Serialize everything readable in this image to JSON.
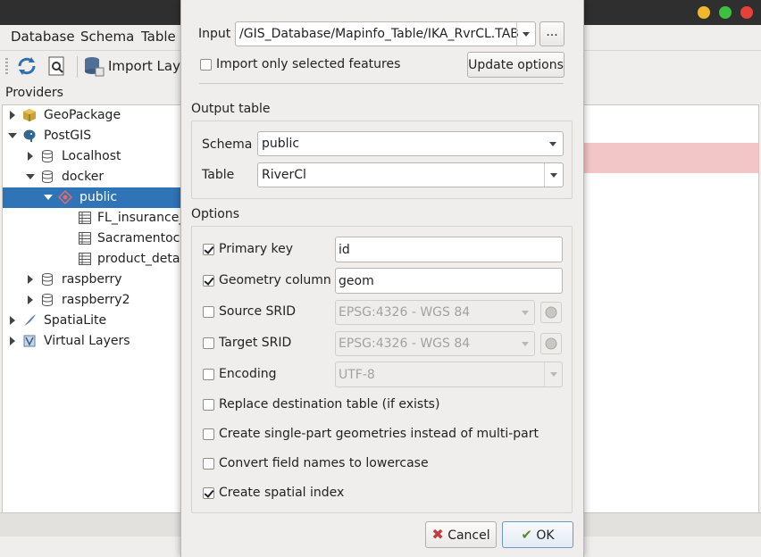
{
  "window": {
    "menu": [
      "Database",
      "Schema",
      "Table"
    ],
    "toolbar_import_label": "Import Layer",
    "providers_heading": "Providers",
    "tree": [
      {
        "label": "GeoPackage",
        "icon": "geopackage-icon"
      },
      {
        "label": "PostGIS",
        "icon": "postgis-elephant-icon"
      },
      {
        "label": "Localhost",
        "icon": "database-icon"
      },
      {
        "label": "docker",
        "icon": "database-icon"
      },
      {
        "label": "public",
        "icon": "schema-icon"
      },
      {
        "label": "FL_insurance_",
        "icon": "table-icon"
      },
      {
        "label": "Sacramentocr",
        "icon": "table-icon"
      },
      {
        "label": "product_detail",
        "icon": "table-icon"
      },
      {
        "label": "raspberry",
        "icon": "database-icon"
      },
      {
        "label": "raspberry2",
        "icon": "database-icon"
      },
      {
        "label": "SpatiaLite",
        "icon": "spatialite-feather-icon"
      },
      {
        "label": "Virtual Layers",
        "icon": "virtual-layers-icon"
      }
    ]
  },
  "dialog": {
    "input_label": "Input",
    "input_value": "/GIS_Database/Mapinfo_Table/IKA_RvrCL.TAB",
    "browse_label": "...",
    "import_selected_label": "Import only selected features",
    "import_selected_checked": false,
    "update_options_label": "Update options",
    "output_table_title": "Output table",
    "schema_label": "Schema",
    "schema_value": "public",
    "table_label": "Table",
    "table_value": "RiverCl",
    "options_title": "Options",
    "options": {
      "primary_key": {
        "label": "Primary key",
        "checked": true,
        "value": "id"
      },
      "geometry_column": {
        "label": "Geometry column",
        "checked": true,
        "value": "geom"
      },
      "source_srid": {
        "label": "Source SRID",
        "checked": false,
        "value": "EPSG:4326 - WGS 84"
      },
      "target_srid": {
        "label": "Target SRID",
        "checked": false,
        "value": "EPSG:4326 - WGS 84"
      },
      "encoding": {
        "label": "Encoding",
        "checked": false,
        "value": "UTF-8"
      },
      "replace_table": {
        "label": "Replace destination table (if exists)",
        "checked": false
      },
      "single_part": {
        "label": "Create single-part geometries instead of multi-part",
        "checked": false
      },
      "lowercase": {
        "label": "Convert field names to lowercase",
        "checked": false
      },
      "spatial_index": {
        "label": "Create spatial index",
        "checked": true
      }
    },
    "cancel_label": "Cancel",
    "ok_label": "OK"
  }
}
